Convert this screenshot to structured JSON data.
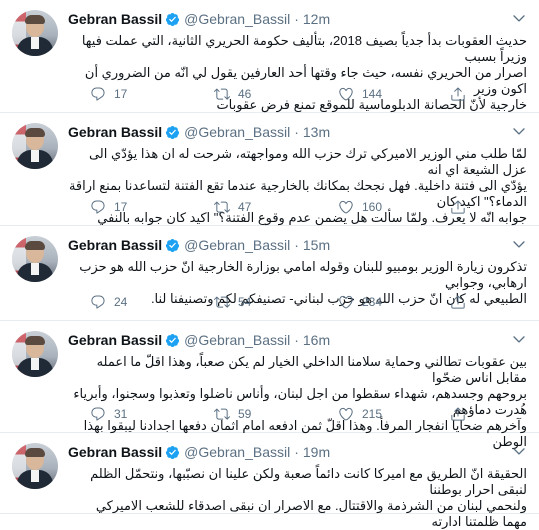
{
  "tweets": [
    {
      "name": "Gebran Bassil",
      "handle": "@Gebran_Bassil",
      "time": "12m",
      "text": "حديث العقوبات بدأ جدياً بصيف 2018، بتأليف حكومة الحريري الثانية، التي عملت فيها وزيراً بسبب\nاصرار من الحريري نفسه، حيث جاء وقتها أحد العارفين يقول لي انّه من الضروري أن اكون وزير\nخارجية لأنّ الحصانة الدبلوماسية للموقع تمنع فرض عقوبات",
      "reply": "17",
      "retweet": "46",
      "like": "144"
    },
    {
      "name": "Gebran Bassil",
      "handle": "@Gebran_Bassil",
      "time": "13m",
      "text": "لمّا طلب مني الوزير الاميركي ترك حزب الله ومواجهته، شرحت له ان هذا يؤدّي الى عزل الشيعة اي انه\nيؤدّي الى فتنة داخلية. فهل نجحك بمكانك بالخارجية عندما تقع الفتنة لتساعدنا بمنع اراقة الدماء؟\" اكيد كان\nجوابه انّه لا يعرف. ولمّا سألت هل يضمن عدم وقوع الفتنة؟\" اكيد كان جوابه بالنفي",
      "reply": "17",
      "retweet": "47",
      "like": "160"
    },
    {
      "name": "Gebran Bassil",
      "handle": "@Gebran_Bassil",
      "time": "15m",
      "text": "تذكرون زيارة الوزير بومبيو للبنان وقوله امامي بوزارة الخارجية انّ حزب الله هو حزب ارهابي، وجوابي\nالطبيعي له كان انّ حزب الله هو حزب لبناني- تصنيفكم لكم وتصنيفنا لنا.",
      "reply": "24",
      "retweet": "54",
      "like": "234"
    },
    {
      "name": "Gebran Bassil",
      "handle": "@Gebran_Bassil",
      "time": "16m",
      "text": "بين عقوبات تطالني وحماية سلامنا الداخلي  الخيار لم يكن صعباً، وهذا اقلّ ما اعمله مقابل اناس ضحّوا\nبروحهم وجسدهم، شهداء سقطوا من اجل لبنان، وأناس ناضلوا وتعذبوا وسجنوا، وأبرياء هُدرت دماؤهم\nوآخرهم ضحايا انفجار المرفأ.  وهذا اقلّ ثمن ادفعه امام اثمان دفعها اجدادنا ليبقوا بهذا الوطن",
      "reply": "31",
      "retweet": "59",
      "like": "215"
    },
    {
      "name": "Gebran Bassil",
      "handle": "@Gebran_Bassil",
      "time": "19m",
      "text": "الحقيقة انّ الطريق مع اميركا كانت دائماً صعبة ولكن علينا ان نصبّبها، ونتحمّل الظلم لنبقى احرار بوطننا\nولنحمي لبنان من الشرذمة والاقتتال. مع الاصرار ان نبقى اصدقاء للشعب الاميركي مهما ظلمتنا ادارته"
    }
  ]
}
